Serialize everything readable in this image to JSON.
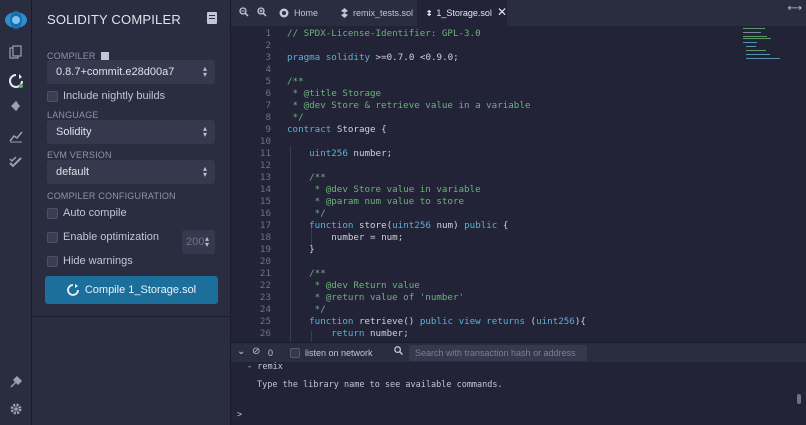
{
  "rail": {
    "icons": [
      "remix-logo-icon",
      "file-explorer-icon",
      "solidity-compiler-icon",
      "deploy-run-icon",
      "analysis-icon",
      "unit-testing-icon",
      "plugin-manager-icon",
      "settings-icon"
    ]
  },
  "panel": {
    "title": "SOLIDITY COMPILER",
    "compiler_label": "COMPILER",
    "compiler_value": "0.8.7+commit.e28d00a7",
    "nightly_label": "Include nightly builds",
    "language_label": "LANGUAGE",
    "language_value": "Solidity",
    "evm_label": "EVM VERSION",
    "evm_value": "default",
    "config_label": "COMPILER CONFIGURATION",
    "auto_compile_label": "Auto compile",
    "optimization_label": "Enable optimization",
    "optimization_runs": "200",
    "hide_warnings_label": "Hide warnings",
    "compile_button": "Compile 1_Storage.sol"
  },
  "editor": {
    "tabs": [
      {
        "label": "Home",
        "icon": "home-icon"
      },
      {
        "label": "remix_tests.sol",
        "icon": "solidity-file-icon"
      },
      {
        "label": "1_Storage.sol",
        "icon": "solidity-file-icon",
        "active": true
      }
    ],
    "line_numbers": [
      "1",
      "2",
      "3",
      "4",
      "5",
      "6",
      "7",
      "8",
      "9",
      "10",
      "11",
      "12",
      "13",
      "14",
      "15",
      "16",
      "17",
      "18",
      "19",
      "20",
      "21",
      "22",
      "23",
      "24",
      "25",
      "26"
    ],
    "code": [
      "// SPDX-License-Identifier: GPL-3.0",
      "",
      "pragma solidity >=0.7.0 <0.9.0;",
      "",
      "/**",
      " * @title Storage",
      " * @dev Store & retrieve value in a variable",
      " */",
      "contract Storage {",
      "",
      "    uint256 number;",
      "",
      "    /**",
      "     * @dev Store value in variable",
      "     * @param num value to store",
      "     */",
      "    function store(uint256 num) public {",
      "        number = num;",
      "    }",
      "",
      "    /**",
      "     * @dev Return value",
      "     * @return value of 'number'",
      "     */",
      "    function retrieve() public view returns (uint256){",
      "        return number;"
    ]
  },
  "terminal": {
    "count": "0",
    "listen_label": "listen on network",
    "search_placeholder": "Search with transaction hash or address",
    "lines": [
      "- remix",
      "Type the library name to see available commands."
    ],
    "prompt": ">"
  },
  "colors": {
    "accent": "#1b6f9a",
    "panel_bg": "#2a2c3f",
    "editor_bg": "#222336",
    "comment": "#6bb27b",
    "keyword": "#5ab1d6"
  }
}
